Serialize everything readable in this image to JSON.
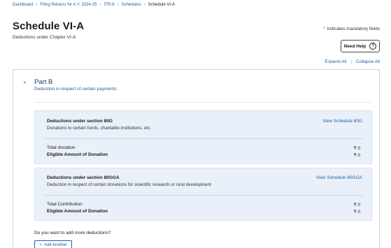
{
  "breadcrumb": {
    "items": [
      "Dashboard",
      "Filing Returns for A.Y. 2024-25",
      "ITR-6",
      "Schedules"
    ],
    "current": "Schedule VI-A",
    "separator": "›"
  },
  "page": {
    "title": "Schedule VI-A",
    "subtitle": "Deductions under Chapter VI-A",
    "mandatory_star": "*",
    "mandatory_note": "Indicates mandatory fields",
    "need_help_label": "Need Help",
    "help_icon_glyph": "?",
    "expand_all": "Expand All",
    "collapse_all": "Collapse All",
    "pipe": "|"
  },
  "part_b": {
    "chevron_glyph": "⌄",
    "title": "Part B",
    "description": "Deduction in respect of certain payments",
    "sections": [
      {
        "title": "Deductions under section 80G",
        "description": "Donations to certain funds, charitable institutions, etc.",
        "view_link": "View Schedule 80G",
        "rows": [
          {
            "label": "Total donation",
            "value": "₹ 0"
          },
          {
            "label": "Eligible Amount of Donation",
            "value": "₹ 0"
          }
        ]
      },
      {
        "title": "Deductions under section 80GGA",
        "description": "Deduction in respect of certain donations for scientific research or rural development",
        "view_link": "View Schedule 80GGA",
        "rows": [
          {
            "label": "Total Contribution",
            "value": "₹ 0"
          },
          {
            "label": "Eligible Amount of Donation",
            "value": "₹ 0"
          }
        ]
      }
    ],
    "more_question": "Do you want to add more deductions?",
    "add_another_icon": "+",
    "add_another_label": "Add Another"
  },
  "colors": {
    "link": "#1f5fa8",
    "block_bg": "#e9f0f9",
    "mandatory_star": "#d32f2f"
  }
}
